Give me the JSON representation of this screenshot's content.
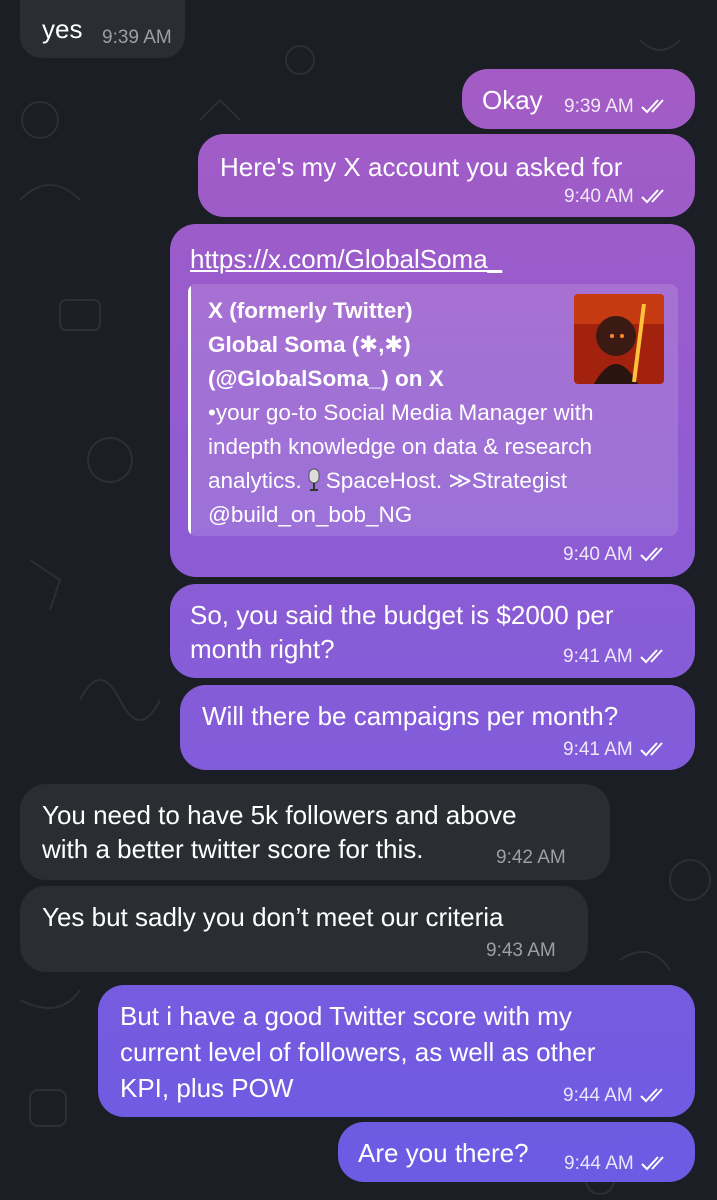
{
  "messages": [
    {
      "text": "yes",
      "time": "9:39 AM"
    },
    {
      "text": "Okay",
      "time": "9:39 AM"
    },
    {
      "text": "Here's my X account you asked for",
      "time": "9:40 AM"
    },
    {
      "link": "https://x.com/GlobalSoma_",
      "time": "9:40 AM",
      "preview": {
        "site": "X (formerly Twitter)",
        "title_line1": "Global Soma (✱,✱)",
        "title_line2": "(@GlobalSoma_) on X",
        "desc_line1": "•your go-to Social Media Manager with",
        "desc_line2": "indepth knowledge on data & research",
        "desc_line3a": "analytics.",
        "desc_line3b": "SpaceHost. ≫Strategist",
        "desc_line4": "@build_on_bob_NG"
      }
    },
    {
      "line1": "So, you said the budget is $2000 per",
      "line2": "month right?",
      "time": "9:41 AM"
    },
    {
      "text": "Will there be campaigns per month?",
      "time": "9:41 AM"
    },
    {
      "line1": "You need to have 5k followers and above",
      "line2": "with a better twitter score for this.",
      "time": "9:42 AM"
    },
    {
      "text": "Yes but sadly you don’t meet our criteria",
      "time": "9:43 AM"
    },
    {
      "line1": "But i have a good Twitter score with my",
      "line2": "current level of followers, as well as other",
      "line3": "KPI, plus POW",
      "time": "9:44 AM"
    },
    {
      "text": "Are you there?",
      "time": "9:44 AM"
    }
  ],
  "colors": {
    "background": "#1b1e24",
    "incoming": "#2a2d31",
    "outgoing_top": "#a25ec4",
    "outgoing_bottom": "#6c5be0"
  },
  "icons": [
    "double-check-icon",
    "microphone-emoji",
    "avatar-thumbnail"
  ]
}
